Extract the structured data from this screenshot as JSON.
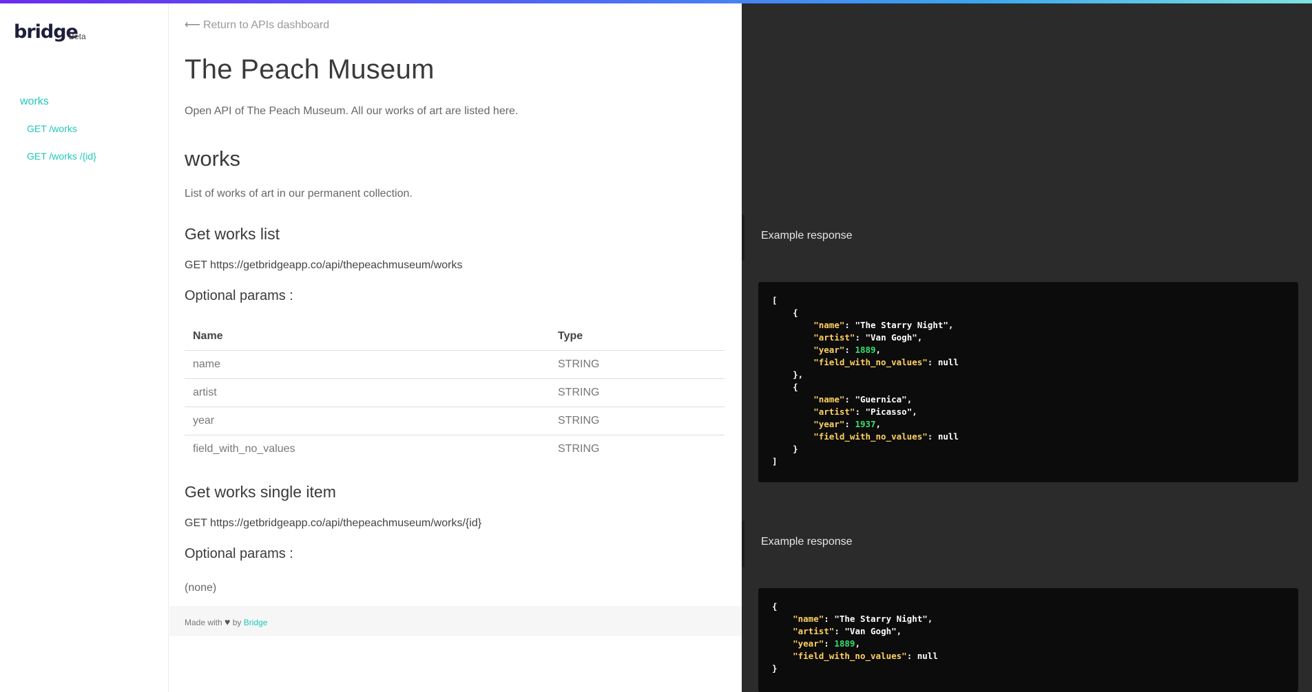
{
  "colors": {
    "accent": "#1fc8b8",
    "code_key": "#ffd060",
    "code_number": "#37e06f",
    "code_bg": "#0c0c0c",
    "panel_bg": "#2b2b2b"
  },
  "sidebar": {
    "logo": "bridge",
    "badge": "Beta",
    "section": "works",
    "items": [
      {
        "label": "GET /works"
      },
      {
        "label": "GET /works /{id}"
      }
    ]
  },
  "main": {
    "back_link": "Return to APIs dashboard",
    "back_arrow": "⟵",
    "title": "The Peach Museum",
    "description": "Open API of The Peach Museum. All our works of art are listed here.",
    "section_title": "works",
    "section_description": "List of works of art in our permanent collection.",
    "endpoints": [
      {
        "title": "Get works list",
        "request": "GET https://getbridgeapp.co/api/thepeachmuseum/works",
        "params_title": "Optional params :",
        "columns": [
          "Name",
          "Type"
        ],
        "params": [
          {
            "name": "name",
            "type": "STRING"
          },
          {
            "name": "artist",
            "type": "STRING"
          },
          {
            "name": "year",
            "type": "STRING"
          },
          {
            "name": "field_with_no_values",
            "type": "STRING"
          }
        ]
      },
      {
        "title": "Get works single item",
        "request": "GET https://getbridgeapp.co/api/thepeachmuseum/works/{id}",
        "params_title": "Optional params :",
        "params_none": "(none)"
      }
    ]
  },
  "footer": {
    "made_with": "Made with",
    "by": "by",
    "link": "Bridge",
    "heart_icon": "heart-icon"
  },
  "examples": [
    {
      "label": "Example response",
      "items": [
        {
          "name": "\"The Starry Night\"",
          "artist": "\"Van Gogh\"",
          "year": "1889",
          "field_with_no_values": "null"
        },
        {
          "name": "\"Guernica\"",
          "artist": "\"Picasso\"",
          "year": "1937",
          "field_with_no_values": "null"
        }
      ]
    },
    {
      "label": "Example response",
      "item": {
        "name": "\"The Starry Night\"",
        "artist": "\"Van Gogh\"",
        "year": "1889",
        "field_with_no_values": "null"
      }
    }
  ]
}
